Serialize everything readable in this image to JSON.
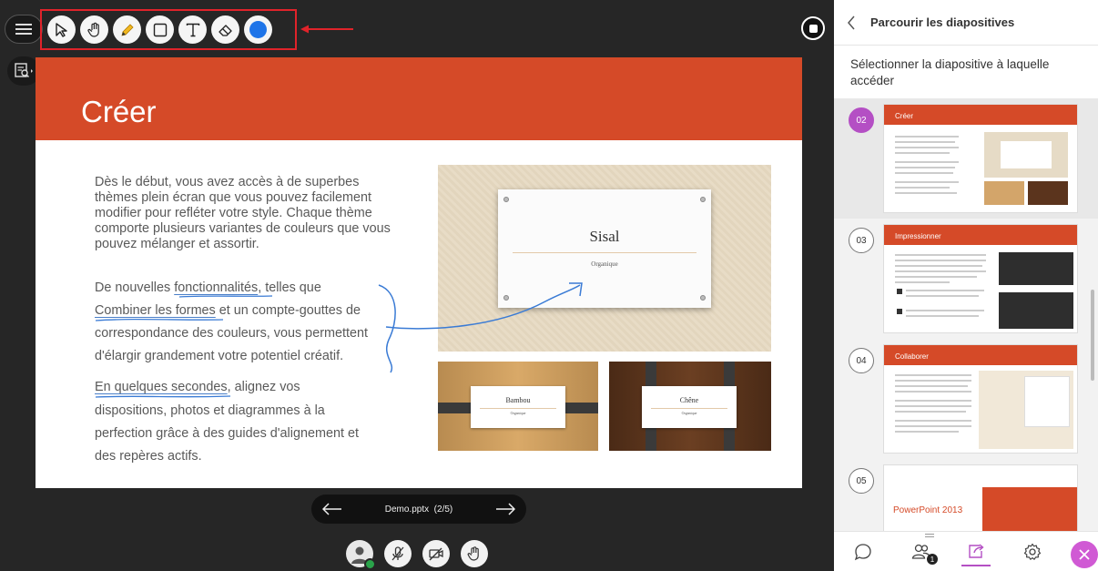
{
  "toolbar": {
    "tools": [
      {
        "icon": "select-arrow-icon"
      },
      {
        "icon": "pan-hand-icon"
      },
      {
        "icon": "pencil-icon"
      },
      {
        "icon": "rectangle-icon"
      },
      {
        "icon": "text-icon"
      },
      {
        "icon": "eraser-icon"
      },
      {
        "icon": "color-picker-icon",
        "color": "#1e74e8"
      }
    ],
    "highlight_color": "#e0232a"
  },
  "slide": {
    "title": "Créer",
    "header_color": "#d54a28",
    "paragraph1": "Dès le début, vous avez accès à de superbes thèmes plein écran que vous pouvez facilement modifier pour refléter votre style. Chaque thème comporte plusieurs variantes de couleurs que vous pouvez mélanger et assortir.",
    "paragraph2": {
      "before": "De nouvelles ",
      "link1": "fonctionnalités",
      "mid1": ", telles que",
      "link2": "Combiner les formes",
      "mid2": " et un compte-gouttes de",
      "line3": "correspondance des couleurs, vous permettent",
      "line4": "d'élargir grandement votre potentiel créatif."
    },
    "paragraph3": {
      "link": "En quelques secondes",
      "after": ", alignez vos",
      "line2": "dispositions, photos et diagrammes à la",
      "line3": "perfection grâce à des guides d'alignement et",
      "line4": "des repères actifs."
    },
    "images": {
      "main": {
        "title": "Sisal",
        "subtitle": "Organique"
      },
      "left": {
        "title": "Bambou",
        "subtitle": "Organique"
      },
      "right": {
        "title": "Chêne",
        "subtitle": "Organique"
      }
    }
  },
  "slide_nav": {
    "file": "Demo.pptx",
    "position": "(2/5)"
  },
  "panel": {
    "title": "Parcourir les diapositives",
    "subtitle": "Sélectionner la diapositive à laquelle accéder",
    "slides": [
      {
        "number": "02",
        "title": "Créer",
        "current": true
      },
      {
        "number": "03",
        "title": "Impressionner",
        "current": false
      },
      {
        "number": "04",
        "title": "Collaborer",
        "current": false
      },
      {
        "number": "05",
        "title": "PowerPoint 2013",
        "current": false
      }
    ],
    "footer": {
      "participants_count": "1"
    },
    "accent_color": "#b44fc4"
  }
}
